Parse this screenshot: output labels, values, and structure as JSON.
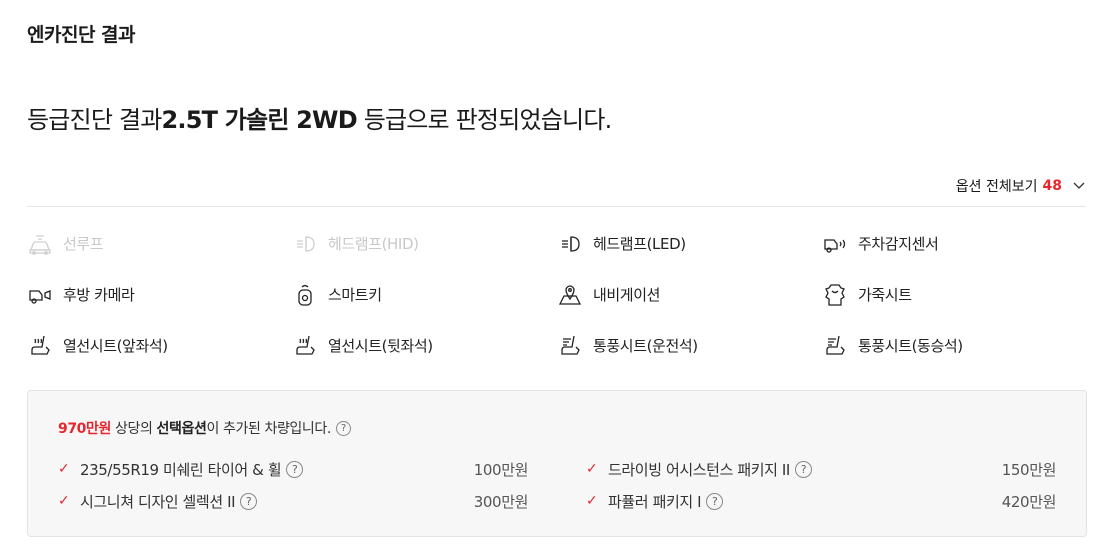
{
  "section_title": "엔카진단 결과",
  "headline": {
    "prefix": "등급진단 결과",
    "grade": "2.5T 가솔린 2WD",
    "suffix": "등급으로 판정되었습니다."
  },
  "options_toggle": {
    "label": "옵션 전체보기",
    "count": "48"
  },
  "options": [
    {
      "label": "선루프",
      "icon": "sunroof-icon",
      "enabled": false
    },
    {
      "label": "헤드램프(HID)",
      "icon": "headlamp-icon",
      "enabled": false
    },
    {
      "label": "헤드램프(LED)",
      "icon": "headlamp-icon",
      "enabled": true
    },
    {
      "label": "주차감지센서",
      "icon": "parking-sensor-icon",
      "enabled": true
    },
    {
      "label": "후방 카메라",
      "icon": "rear-camera-icon",
      "enabled": true
    },
    {
      "label": "스마트키",
      "icon": "smart-key-icon",
      "enabled": true
    },
    {
      "label": "내비게이션",
      "icon": "navigation-icon",
      "enabled": true
    },
    {
      "label": "가죽시트",
      "icon": "leather-seat-icon",
      "enabled": true
    },
    {
      "label": "열선시트(앞좌석)",
      "icon": "heated-seat-icon",
      "enabled": true
    },
    {
      "label": "열선시트(뒷좌석)",
      "icon": "heated-seat-icon",
      "enabled": true
    },
    {
      "label": "통풍시트(운전석)",
      "icon": "ventilated-seat-icon",
      "enabled": true
    },
    {
      "label": "통풍시트(동승석)",
      "icon": "ventilated-seat-icon",
      "enabled": true
    }
  ],
  "panel": {
    "price": "970만원",
    "text_mid": " 상당의 ",
    "text_strong": "선택옵션",
    "text_end": "이 추가된 차량입니다.",
    "help": "?",
    "packages": [
      {
        "name": "235/55R19 미쉐린 타이어 & 휠",
        "amount": "100만원"
      },
      {
        "name": "드라이빙 어시스턴스 패키지 II",
        "amount": "150만원"
      },
      {
        "name": "시그니쳐 디자인 셀렉션 II",
        "amount": "300만원"
      },
      {
        "name": "파퓰러 패키지 I",
        "amount": "420만원"
      }
    ]
  },
  "colors": {
    "accent": "#e8262e",
    "disabled_text": "#c8c8c8",
    "panel_bg": "#f7f7f8"
  }
}
